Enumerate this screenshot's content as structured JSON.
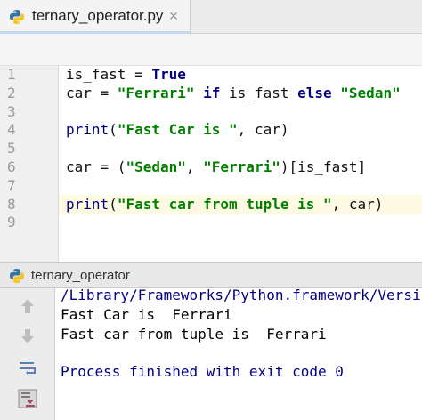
{
  "tab": {
    "label": "ternary_operator.py",
    "close_symbol": "×",
    "icon": "python-file-icon"
  },
  "editor": {
    "line_numbers": [
      "1",
      "2",
      "3",
      "4",
      "5",
      "6",
      "7",
      "8",
      "9"
    ],
    "current_line": "8",
    "lines": [
      [
        {
          "t": "is_fast = ",
          "c": ""
        },
        {
          "t": "True",
          "c": "kw"
        }
      ],
      [
        {
          "t": "car = ",
          "c": ""
        },
        {
          "t": "\"Ferrari\"",
          "c": "str"
        },
        {
          "t": " ",
          "c": ""
        },
        {
          "t": "if",
          "c": "kw"
        },
        {
          "t": " is_fast ",
          "c": ""
        },
        {
          "t": "else",
          "c": "kw"
        },
        {
          "t": " ",
          "c": ""
        },
        {
          "t": "\"Sedan\"",
          "c": "str"
        }
      ],
      [],
      [
        {
          "t": "print",
          "c": "bi"
        },
        {
          "t": "(",
          "c": ""
        },
        {
          "t": "\"Fast Car is \"",
          "c": "str"
        },
        {
          "t": ", car)",
          "c": ""
        }
      ],
      [],
      [
        {
          "t": "car = (",
          "c": ""
        },
        {
          "t": "\"Sedan\"",
          "c": "str"
        },
        {
          "t": ", ",
          "c": ""
        },
        {
          "t": "\"Ferrari\"",
          "c": "str"
        },
        {
          "t": ")[is_fast]",
          "c": ""
        }
      ],
      [],
      [
        {
          "t": "print",
          "c": "bi"
        },
        {
          "t": "(",
          "c": ""
        },
        {
          "t": "\"Fast car from tuple is \"",
          "c": "str"
        },
        {
          "t": ", car)",
          "c": ""
        }
      ],
      []
    ]
  },
  "run_panel": {
    "title": "ternary_operator",
    "icon": "python-run-icon",
    "toolbar": [
      {
        "name": "rerun-up-arrow-icon",
        "enabled": false
      },
      {
        "name": "down-arrow-icon",
        "enabled": false
      },
      {
        "name": "soft-wrap-icon",
        "enabled": true
      },
      {
        "name": "scroll-to-end-icon",
        "enabled": true
      }
    ],
    "output": {
      "path": "/Library/Frameworks/Python.framework/Versi",
      "line1": "Fast Car is  Ferrari",
      "line2": "Fast car from tuple is  Ferrari",
      "blank": "",
      "exit": "Process finished with exit code 0"
    }
  },
  "colors": {
    "keyword": "#000080",
    "string": "#008000",
    "current_line": "#fffae3",
    "gutter": "#f0f0f0"
  }
}
